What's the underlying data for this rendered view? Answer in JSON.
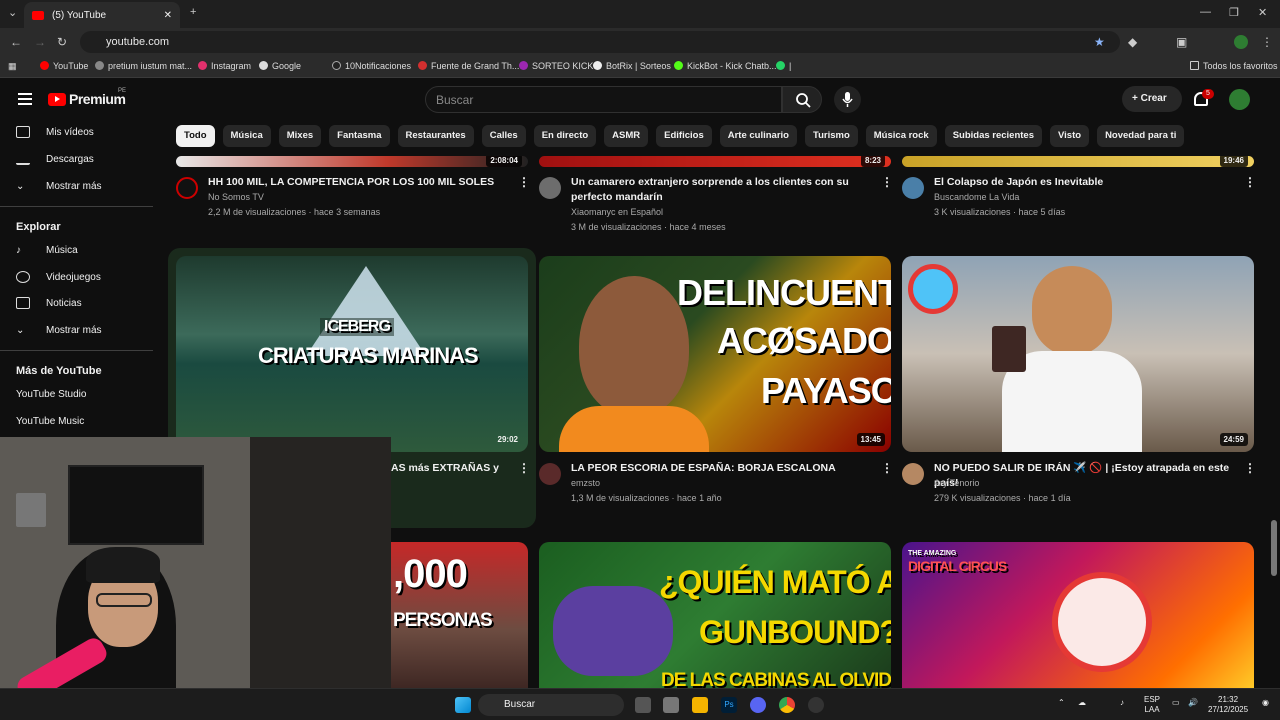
{
  "browser": {
    "tab_title": "(5) YouTube",
    "url": "youtube.com",
    "bookmarks": [
      "YouTube",
      "pretium iustum mat...",
      "Instagram",
      "Google",
      "10Notificaciones",
      "Fuente de Grand Th...",
      "SORTEO KICK",
      "BotRix | Sorteos",
      "KickBot - Kick Chatb...",
      "|"
    ],
    "all_bookmarks": "Todos los favoritos"
  },
  "header": {
    "brand": "Premium",
    "region": "PE",
    "search_placeholder": "Buscar",
    "create_label": "Crear",
    "notifications": "5"
  },
  "chips": [
    "Todo",
    "Música",
    "Mixes",
    "Fantasma",
    "Restaurantes",
    "Calles",
    "En directo",
    "ASMR",
    "Edificios",
    "Arte culinario",
    "Turismo",
    "Música rock",
    "Subidas recientes",
    "Visto",
    "Novedad para ti"
  ],
  "sidebar": {
    "top": [
      "Mis vídeos",
      "Descargas",
      "Mostrar más"
    ],
    "explore_title": "Explorar",
    "explore": [
      "Música",
      "Videojuegos",
      "Noticias",
      "Mostrar más"
    ],
    "more_title": "Más de YouTube",
    "more": [
      "YouTube Studio",
      "YouTube Music"
    ]
  },
  "row1": [
    {
      "title": "HH 100 MIL, LA COMPETENCIA POR LOS 100 MIL SOLES",
      "channel": "No Somos TV",
      "meta": "2,2 M de visualizaciones · hace 3 semanas",
      "duration": "2:08:04"
    },
    {
      "title": "Un camarero extranjero sorprende a los clientes con su perfecto mandarín",
      "channel": "Xiaomanyc en Español",
      "meta": "3 M de visualizaciones · hace 4 meses",
      "duration": "8:23"
    },
    {
      "title": "El Colapso de Japón es Inevitable",
      "channel": "Buscandome La Vida",
      "meta": "3 K visualizaciones · hace 5 días",
      "duration": "19:46"
    }
  ],
  "row2": [
    {
      "title": "AS más EXTRAÑAS y",
      "thumb_text_1": "ICEBERG",
      "thumb_text_2": "CRIATURAS MARINAS",
      "duration": "29:02"
    },
    {
      "title": "LA PEOR ESCORIA DE ESPAÑA: BORJA ESCALONA",
      "channel": "emzsto",
      "meta": "1,3 M de visualizaciones · hace 1 año",
      "duration": "13:45",
      "thumb_lines": [
        "DELINCUENTE",
        "ACØSADOR",
        "PAYASO"
      ]
    },
    {
      "title": "NO PUEDO SALIR DE IRÁN ✈️ 🚫 | ¡Estoy atrapada en este país!",
      "channel": "Ary Tenorio",
      "meta": "279 K visualizaciones · hace 1 día",
      "duration": "24:59"
    }
  ],
  "row3": [
    {
      "thumb_lines": [
        ",000",
        "PERSONAS"
      ]
    },
    {
      "thumb_lines": [
        "¿QUIÉN MATÓ A",
        "GUNBOUND?",
        "DE LAS CABINAS AL OLVIDO"
      ]
    },
    {
      "thumb_lines": [
        "THE AMAZING",
        "DIGITAL CIRCUS"
      ]
    }
  ],
  "taskbar": {
    "search": "Buscar",
    "lang": "ESP",
    "lang2": "LAA",
    "time": "21:32",
    "date": "27/12/2025"
  },
  "colors": {
    "bg": "#0f0f0f",
    "accent": "#ff0000",
    "chip": "#272727"
  }
}
